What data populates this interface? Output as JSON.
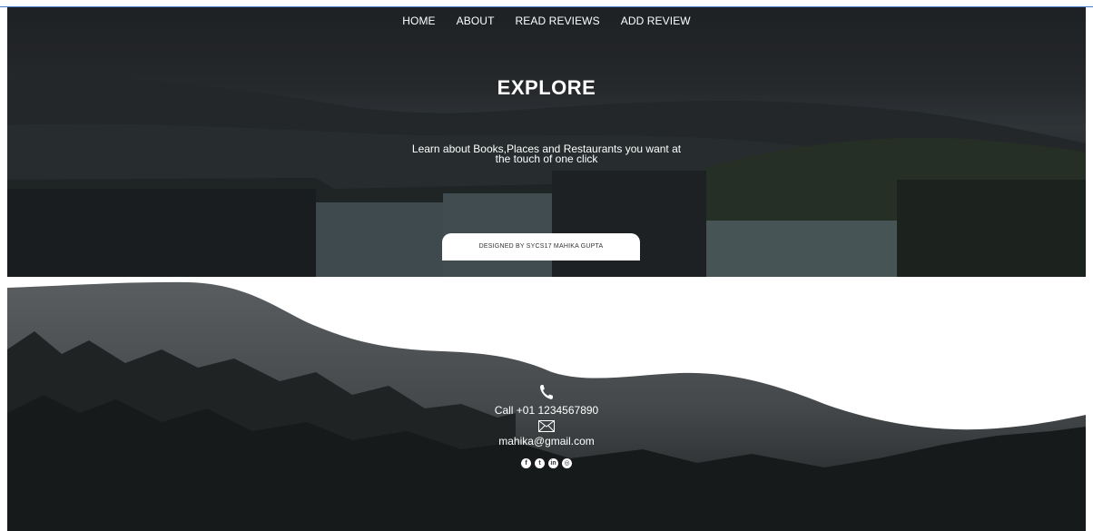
{
  "nav": {
    "items": [
      {
        "label": "HOME"
      },
      {
        "label": "ABOUT"
      },
      {
        "label": "READ REVIEWS"
      },
      {
        "label": "ADD REVIEW"
      }
    ]
  },
  "hero": {
    "title": "EXPLORE",
    "subtitle": "Learn about Books,Places and Restaurants you want at the touch of one click",
    "background_icon": "waterfall-landscape"
  },
  "footer": {
    "background_icon": "misty-forest",
    "phone_icon": "phone-icon",
    "call_text": "Call +01 1234567890",
    "mail_icon": "envelope-icon",
    "email": "mahika@gmail.com",
    "socials": [
      {
        "name": "facebook-icon",
        "glyph": "f"
      },
      {
        "name": "twitter-icon",
        "glyph": "t"
      },
      {
        "name": "linkedin-icon",
        "glyph": "in"
      },
      {
        "name": "instagram-icon",
        "glyph": "◎"
      }
    ],
    "credit": "DESIGNED BY SYCS17 MAHIKA GUPTA"
  },
  "colors": {
    "text": "#ffffff",
    "hero_dark": "#26292c",
    "footer_dark": "#2c2f31",
    "credit_bg": "#ffffff"
  }
}
